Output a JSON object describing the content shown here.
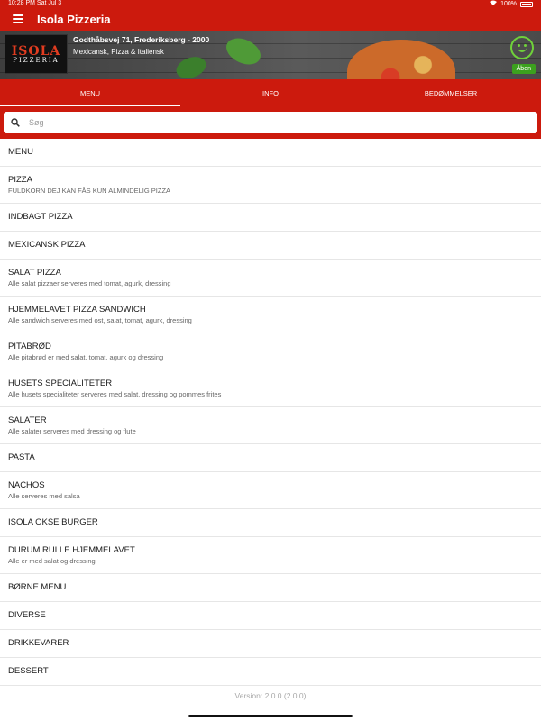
{
  "status_bar": {
    "time": "10:28 PM   Sat Jul 3",
    "battery": "100%"
  },
  "app_bar": {
    "title": "Isola Pizzeria"
  },
  "restaurant": {
    "logo_text_main": "ISOLA",
    "logo_text_sub": "PIZZERIA",
    "address": "Godthåbsvej 71, Frederiksberg - 2000",
    "cuisine": "Mexicansk, Pizza & Italiensk",
    "status_badge": "Åben",
    "status_color": "#3ca11e"
  },
  "tabs": [
    {
      "label": "MENU",
      "active": true
    },
    {
      "label": "INFO",
      "active": false
    },
    {
      "label": "BEDØMMELSER",
      "active": false
    }
  ],
  "search": {
    "placeholder": "Søg"
  },
  "menu_items": [
    {
      "title": "MENU",
      "desc": ""
    },
    {
      "title": "PIZZA",
      "desc": "FULDKORN DEJ KAN FÅS KUN ALMINDELIG PIZZA"
    },
    {
      "title": "INDBAGT PIZZA",
      "desc": ""
    },
    {
      "title": "MEXICANSK PIZZA",
      "desc": ""
    },
    {
      "title": "SALAT PIZZA",
      "desc": "Alle salat pizzaer serveres med tomat, agurk, dressing"
    },
    {
      "title": "HJEMMELAVET PIZZA SANDWICH",
      "desc": "Alle sandwich serveres med ost, salat, tomat, agurk, dressing"
    },
    {
      "title": "PITABRØD",
      "desc": "Alle pitabrød er med salat, tomat, agurk og dressing"
    },
    {
      "title": "HUSETS SPECIALITETER",
      "desc": "Alle husets specialiteter serveres med salat, dressing og pommes frites"
    },
    {
      "title": "SALATER",
      "desc": "Alle salater serveres med dressing og flute"
    },
    {
      "title": "PASTA",
      "desc": ""
    },
    {
      "title": "NACHOS",
      "desc": "Alle serveres med salsa"
    },
    {
      "title": "ISOLA OKSE BURGER",
      "desc": ""
    },
    {
      "title": "DURUM RULLE HJEMMELAVET",
      "desc": "Alle er med salat og dressing"
    },
    {
      "title": "BØRNE MENU",
      "desc": ""
    },
    {
      "title": "DIVERSE",
      "desc": ""
    },
    {
      "title": "DRIKKEVARER",
      "desc": ""
    },
    {
      "title": "DESSERT",
      "desc": ""
    }
  ],
  "footer": {
    "version": "Version: 2.0.0 (2.0.0)"
  },
  "colors": {
    "primary": "#cc1a0d",
    "open_green": "#3ca11e",
    "smiley_green": "#6fd13a"
  },
  "icons": {
    "menu": "hamburger-icon",
    "search": "search-icon",
    "status": "smiley-icon",
    "wifi": "wifi-icon",
    "battery": "battery-icon"
  }
}
